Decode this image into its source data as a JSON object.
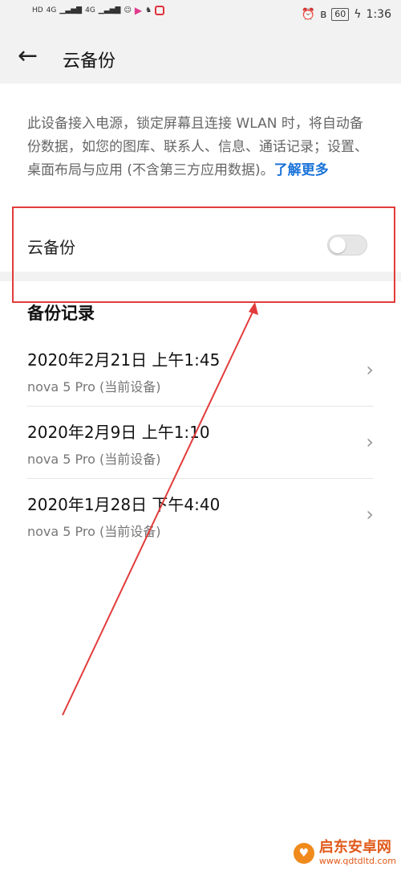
{
  "status_bar": {
    "left_labels": [
      "HD",
      "4G",
      "4G"
    ],
    "battery": "60",
    "time": "1:36"
  },
  "header": {
    "back_icon": "←",
    "title": "云备份"
  },
  "description": {
    "text": "此设备接入电源，锁定屏幕且连接 WLAN 时，将自动备份数据，如您的图库、联系人、信息、通话记录；设置、桌面布局与应用 (不含第三方应用数据)。",
    "link": "了解更多"
  },
  "cloud_backup": {
    "label": "云备份",
    "enabled": false
  },
  "backup_records": {
    "title": "备份记录",
    "items": [
      {
        "date": "2020年2月21日 上午1:45",
        "device": "nova 5 Pro (当前设备)"
      },
      {
        "date": "2020年2月9日 上午1:10",
        "device": "nova 5 Pro (当前设备)"
      },
      {
        "date": "2020年1月28日 下午4:40",
        "device": "nova 5 Pro (当前设备)"
      }
    ]
  },
  "watermark": {
    "name": "启东安卓网",
    "url": "www.qdtdltd.com"
  },
  "colors": {
    "annotation": "#e23b3b",
    "link": "#1a73d9"
  }
}
